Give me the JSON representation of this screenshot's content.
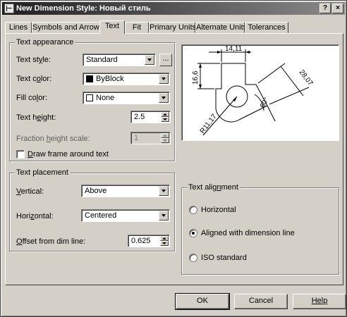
{
  "window": {
    "title": "New Dimension Style: Новый стиль",
    "help_button": "?",
    "close_button": "×"
  },
  "tabs": [
    "Lines",
    "Symbols and Arrows",
    "Text",
    "Fit",
    "Primary Units",
    "Alternate Units",
    "Tolerances"
  ],
  "active_tab": "Text",
  "text_appearance": {
    "title": "Text appearance",
    "style_label_a": "Text st",
    "style_label_u": "y",
    "style_label_b": "le:",
    "style_value": "Standard",
    "style_browse": "...",
    "color_label_a": "Text c",
    "color_label_u": "o",
    "color_label_b": "lor:",
    "color_value": "ByBlock",
    "color_swatch": "#000000",
    "fill_label_a": "Fill co",
    "fill_label_u": "l",
    "fill_label_b": "or:",
    "fill_value": "None",
    "fill_swatch": "#ffffff",
    "height_label_a": "Text h",
    "height_label_u": "e",
    "height_label_b": "ight:",
    "height_value": "2.5",
    "fraction_label_a": "Fraction ",
    "fraction_label_u": "h",
    "fraction_label_b": "eight scale:",
    "fraction_value": "1",
    "frame_label_a": "",
    "frame_label_u": "D",
    "frame_label_b": "raw frame around text"
  },
  "text_placement": {
    "title": "Text placement",
    "vertical_label_a": "",
    "vertical_label_u": "V",
    "vertical_label_b": "ertical:",
    "vertical_value": "Above",
    "horizontal_label_a": "Hori",
    "horizontal_label_u": "z",
    "horizontal_label_b": "ontal:",
    "horizontal_value": "Centered",
    "offset_label_a": "",
    "offset_label_u": "O",
    "offset_label_b": "ffset from dim line:",
    "offset_value": "0.625"
  },
  "text_alignment": {
    "title_a": "Text alig",
    "title_u": "n",
    "title_b": "ment",
    "options": [
      "Horizontal",
      "Aligned with dimension line",
      "ISO standard"
    ],
    "selected": "Aligned with dimension line"
  },
  "preview": {
    "dim_top": "14,11",
    "dim_left": "16,6",
    "dim_right": "28,07",
    "dim_angle": "60°",
    "dim_radius": "R11,17"
  },
  "buttons": {
    "ok": "OK",
    "cancel": "Cancel",
    "help": "Help"
  }
}
